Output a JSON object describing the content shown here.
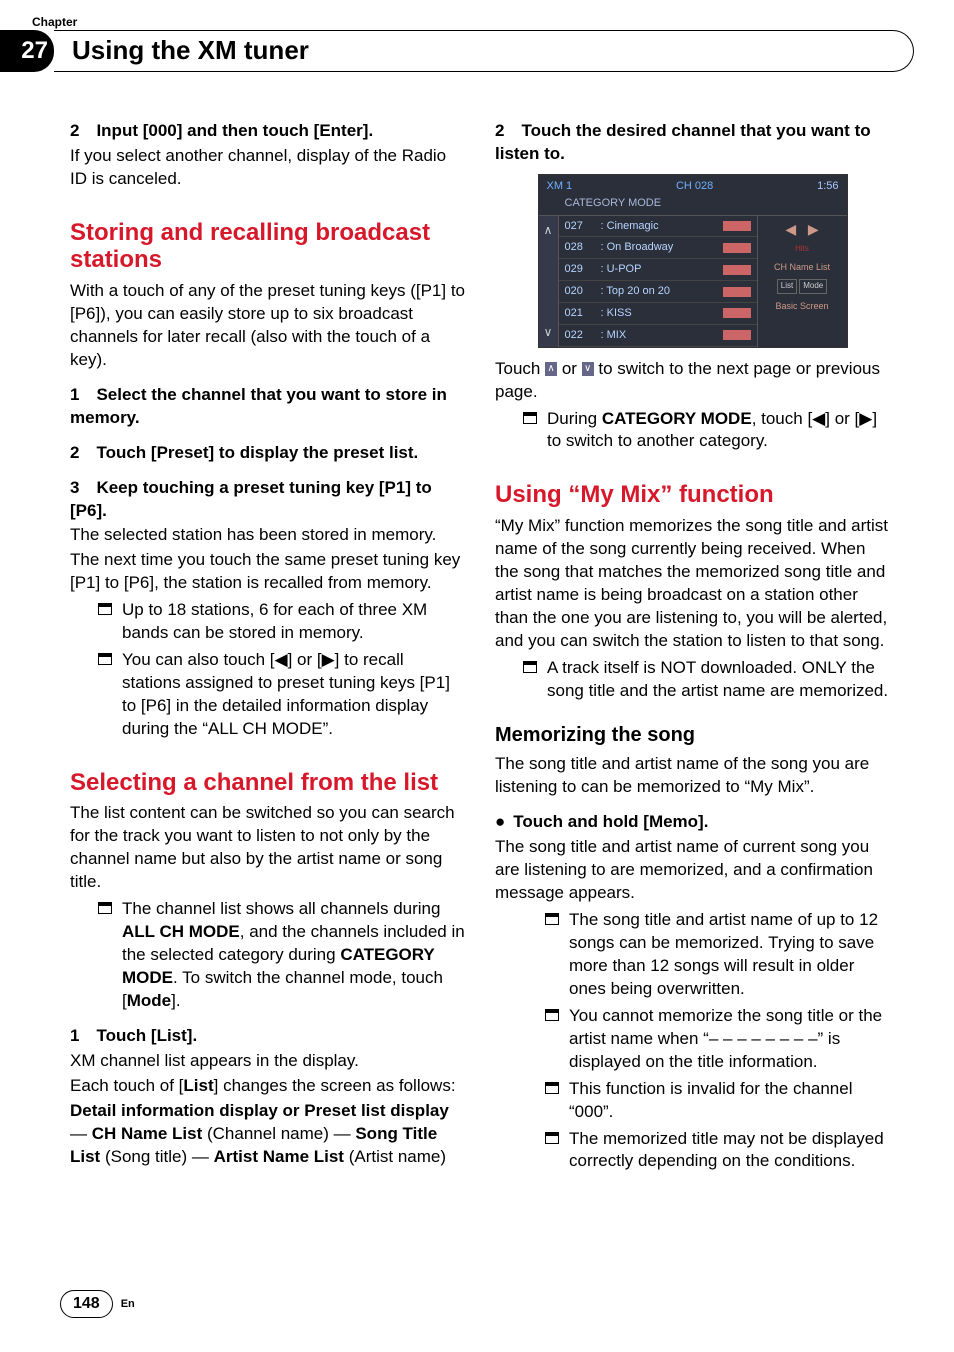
{
  "chapter": {
    "label": "Chapter",
    "number": "27",
    "title": "Using the XM tuner"
  },
  "left": {
    "s2_title": "2 Input [000] and then touch [Enter].",
    "s2_body": "If you select another channel, display of the Radio ID is canceled.",
    "h_storing": "Storing and recalling broadcast stations",
    "storing_body": "With a touch of any of the preset tuning keys ([P1] to [P6]), you can easily store up to six broadcast channels for later recall (also with the touch of a key).",
    "store_s1": "1 Select the channel that you want to store in memory.",
    "store_s2": "2 Touch [Preset] to display the preset list.",
    "store_s3": "3 Keep touching a preset tuning key [P1] to [P6].",
    "store_s3_body1": "The selected station has been stored in memory.",
    "store_s3_body2": "The next time you touch the same preset tuning key [P1] to [P6], the station is recalled from memory.",
    "store_note1": "Up to 18 stations, 6 for each of three XM bands can be stored in memory.",
    "store_note2_a": "You can also touch [",
    "store_note2_b": "] or [",
    "store_note2_c": "] to recall stations assigned to preset tuning keys [P1] to [P6] in the detailed information display during the “ALL CH MODE”.",
    "h_select": "Selecting a channel from the list",
    "select_body": "The list content can be switched so you can search for the track you want to listen to not only by the channel name but also by the artist name or song title.",
    "select_note_a": "The channel list shows all channels during ",
    "select_note_b": "ALL CH MODE",
    "select_note_c": ", and the channels included in the selected category during ",
    "select_note_d": "CATEGORY MODE",
    "select_note_e": ". To switch the channel mode, touch [",
    "select_note_f": "Mode",
    "select_note_g": "].",
    "sel_s1": "1 Touch [List].",
    "sel_s1_body1": "XM channel list appears in the display.",
    "sel_s1_body2_a": "Each touch of [",
    "sel_s1_body2_b": "List",
    "sel_s1_body2_c": "] changes the screen as follows:",
    "sel_flow_a": "Detail information display or Preset list display",
    "sel_flow_dash": " — ",
    "sel_flow_b": "CH Name List",
    "sel_flow_b2": " (Channel name) — ",
    "sel_flow_c": "Song Title List",
    "sel_flow_c2": " (Song title) — ",
    "sel_flow_d": "Artist Name List",
    "sel_flow_d2": " (Artist name)"
  },
  "right": {
    "s2_title": "2 Touch the desired channel that you want to listen to.",
    "touch_body_a": "Touch ",
    "touch_body_b": " or ",
    "touch_body_c": " to switch to the next page or previous page.",
    "cat_note_a": "During ",
    "cat_note_b": "CATEGORY MODE",
    "cat_note_c": ", touch [",
    "cat_note_d": "] or [",
    "cat_note_e": "] to switch to another category.",
    "h_mymix": "Using “My Mix” function",
    "mymix_body": "“My Mix” function memorizes the song title and artist name of the song currently being received. When the song that matches the memorized song title and artist name is being broadcast on a station other than the one you are listening to, you will be alerted, and you can switch the station to listen to that song.",
    "mymix_note": "A track itself is NOT downloaded. ONLY the song title and the artist name are memorized.",
    "h_memo": "Memorizing the song",
    "memo_body": "The song title and artist name of the song you are listening to can be memorized to “My Mix”.",
    "memo_step": "Touch and hold [Memo].",
    "memo_step_body": "The song title and artist name of current song you are listening to are memorized, and a confirmation message appears.",
    "memo_n1": "The song title and artist name of up to 12 songs can be memorized. Trying to save more than 12 songs will result in older ones being overwritten.",
    "memo_n2": "You cannot memorize the song title or the artist name when “– – – – – – – –” is displayed on the title information.",
    "memo_n3": "This function is invalid for the channel “000”.",
    "memo_n4": "The memorized title may not be displayed correctly depending on the conditions."
  },
  "screenshot": {
    "xm": "XM 1",
    "mode": "CATEGORY MODE",
    "ch": "CH 028",
    "time": "1:56",
    "rows": [
      {
        "n": "027",
        "name": ": Cinemagic"
      },
      {
        "n": "028",
        "name": ": On Broadway"
      },
      {
        "n": "029",
        "name": ": U-POP"
      },
      {
        "n": "020",
        "name": ": Top 20 on 20"
      },
      {
        "n": "021",
        "name": ": KISS"
      },
      {
        "n": "022",
        "name": ": MIX"
      }
    ],
    "hits": "Hits",
    "chname": "CH Name List",
    "list": "List",
    "modebtn": "Mode",
    "basic": "Basic Screen"
  },
  "footer": {
    "page": "148",
    "lang": "En"
  }
}
